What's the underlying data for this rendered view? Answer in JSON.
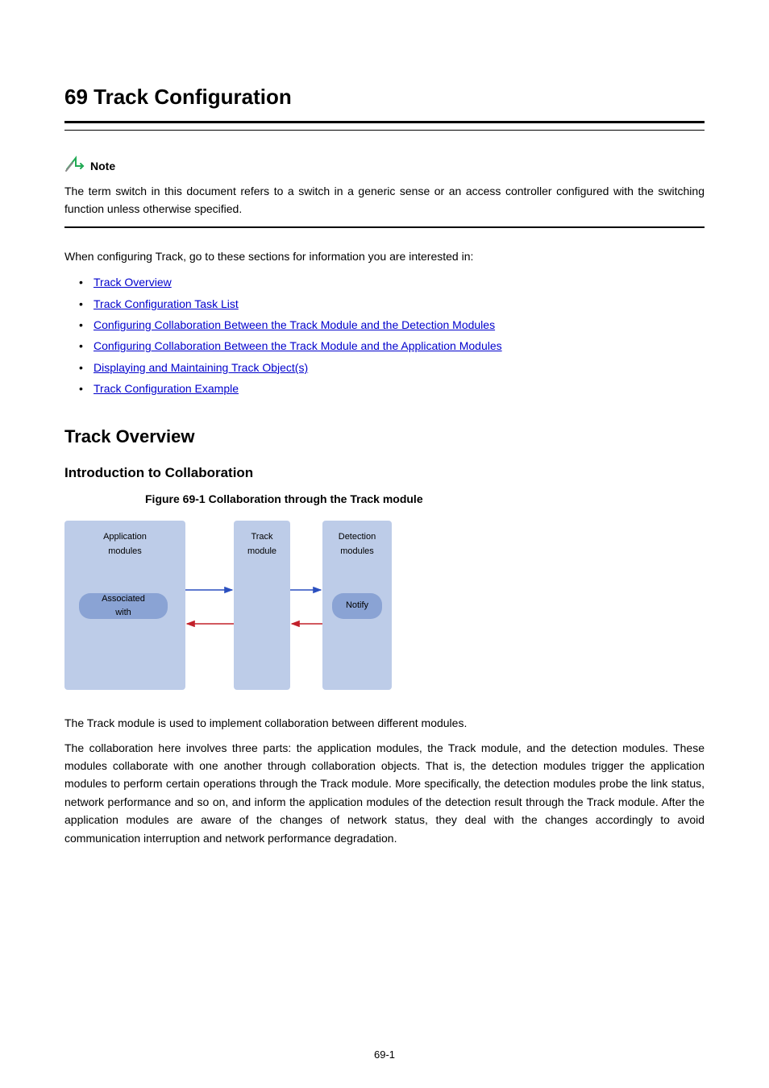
{
  "chapter": {
    "title": "69  Track Configuration"
  },
  "note": {
    "label": "Note",
    "body": "The term switch in this document refers to a switch in a generic sense or an access controller configured with the switching function unless otherwise specified."
  },
  "intro": "When configuring Track, go to these sections for information you are interested in:",
  "links": [
    "Track Overview",
    "Track Configuration Task List",
    "Configuring Collaboration Between the Track Module and the Detection Modules",
    "Configuring Collaboration Between the Track Module and the Application Modules",
    "Displaying and Maintaining Track Object(s)",
    "Track Configuration Example"
  ],
  "section": {
    "title": "Track Overview"
  },
  "subsection": {
    "title": "Introduction to Collaboration"
  },
  "figure": {
    "caption_prefix": "Figure 69-1",
    "caption": "Collaboration through the Track module",
    "boxes": {
      "app": "Application\nmodules",
      "track": "Track\nmodule",
      "detect": "Detection\nmodules",
      "assoc": "Associated\nwith",
      "notify": "Notify"
    }
  },
  "paragraphs": {
    "p1": "The Track module is used to implement collaboration between different modules.",
    "p2": "The collaboration here involves three parts: the application modules, the Track module, and the detection modules. These modules collaborate with one another through collaboration objects. That is, the detection modules trigger the application modules to perform certain operations through the Track module. More specifically, the detection modules probe the link status, network performance and so on, and inform the application modules of the detection result through the Track module. After the application modules are aware of the changes of network status, they deal with the changes accordingly to avoid communication interruption and network performance degradation."
  },
  "page_number": "69-1"
}
